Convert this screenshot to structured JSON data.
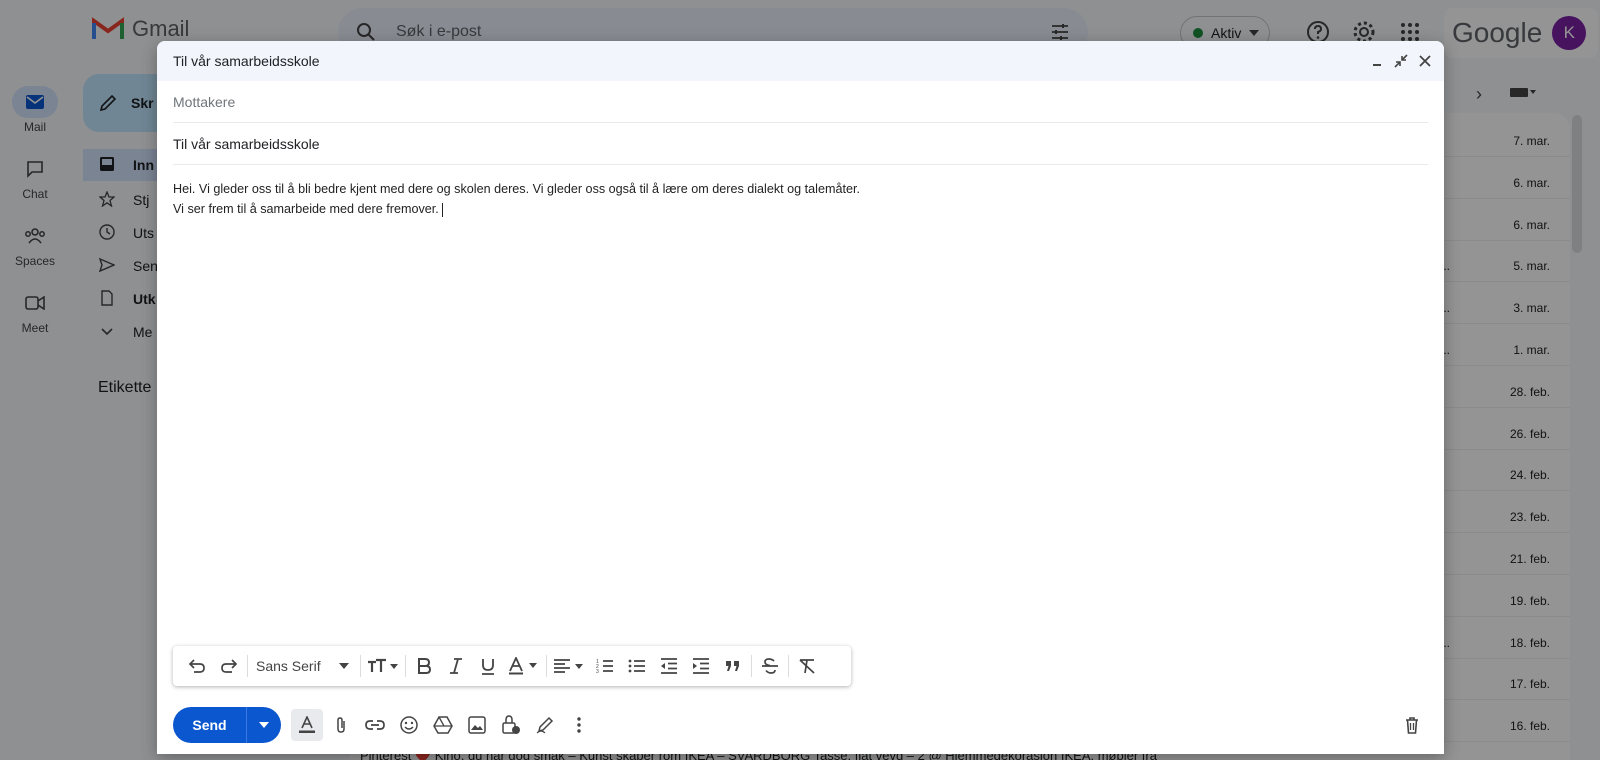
{
  "gmail": {
    "logo_text": "Gmail",
    "search_placeholder": "Søk i e-post",
    "status_label": "Aktiv",
    "google_word": "Google",
    "avatar_letter": "K",
    "rail": [
      {
        "label": "Mail",
        "icon": "mail-icon"
      },
      {
        "label": "Chat",
        "icon": "chat-icon"
      },
      {
        "label": "Spaces",
        "icon": "spaces-icon"
      },
      {
        "label": "Meet",
        "icon": "meet-icon"
      }
    ],
    "compose_label": "Skr",
    "nav": [
      {
        "label": "Inn",
        "icon": "inbox-icon"
      },
      {
        "label": "Stj",
        "icon": "star-icon"
      },
      {
        "label": "Uts",
        "icon": "clock-icon"
      },
      {
        "label": "Sen",
        "icon": "send-icon"
      },
      {
        "label": "Utk",
        "icon": "draft-icon"
      },
      {
        "label": "Me",
        "icon": "chevron-down-icon"
      }
    ],
    "labels_heading": "Etikette",
    "dates": [
      "7. mar.",
      "6. mar.",
      "6. mar.",
      "5. mar.",
      "3. mar.",
      "1. mar.",
      "28. feb.",
      "26. feb.",
      "24. feb.",
      "23. feb.",
      "21. feb.",
      "19. feb.",
      "18. feb.",
      "17. feb.",
      "16. feb."
    ],
    "bottom_row": "Pinterest          ❤️ Kino, du har god smak – Kunst skaper rom IKEA – SVARDBORG Tasse, flat vevd – 2 @ Hjemmedekorasjon IKEA, møbler fra"
  },
  "compose": {
    "title": "Til vår samarbeidsskole",
    "recipients_placeholder": "Mottakere",
    "subject": "Til vår samarbeidsskole",
    "body_line1": "Hei. Vi gleder oss til å bli bedre kjent med dere og skolen deres. Vi gleder oss også til å lære om deres dialekt og talemåter.",
    "body_line2": "Vi ser frem til å samarbeide med dere fremover.",
    "font_name": "Sans Serif",
    "send_label": "Send"
  }
}
